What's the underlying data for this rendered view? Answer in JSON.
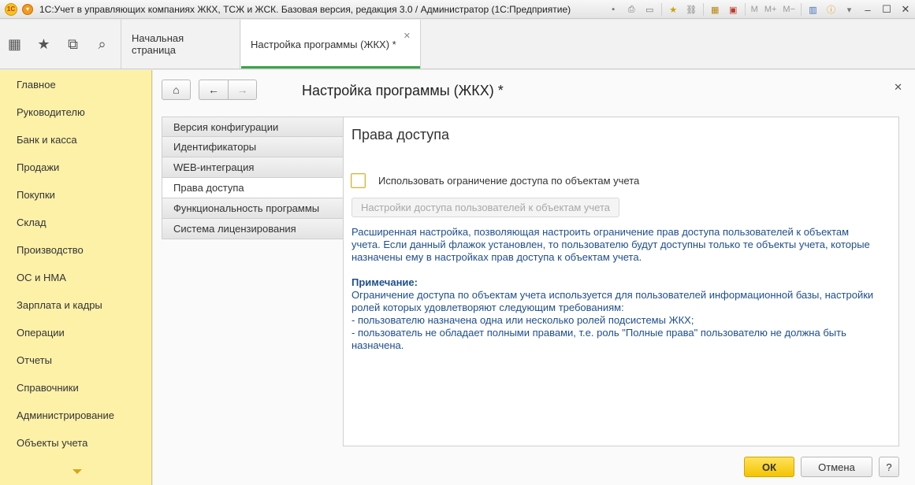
{
  "window": {
    "title": "1С:Учет в управляющих компаниях ЖКХ, ТСЖ и ЖСК. Базовая версия, редакция 3.0 / Администратор  (1С:Предприятие)",
    "logo_text": "1С",
    "toolbar_m": "M",
    "toolbar_m_plus": "M+",
    "toolbar_m_minus": "M−"
  },
  "tabs": {
    "home": "Начальная страница",
    "active": "Настройка программы (ЖКХ) *"
  },
  "sidebar": {
    "items": [
      {
        "label": "Главное"
      },
      {
        "label": "Руководителю"
      },
      {
        "label": "Банк и касса"
      },
      {
        "label": "Продажи"
      },
      {
        "label": "Покупки"
      },
      {
        "label": "Склад"
      },
      {
        "label": "Производство"
      },
      {
        "label": "ОС и НМА"
      },
      {
        "label": "Зарплата и кадры"
      },
      {
        "label": "Операции"
      },
      {
        "label": "Отчеты"
      },
      {
        "label": "Справочники"
      },
      {
        "label": "Администрирование"
      },
      {
        "label": "Объекты учета"
      }
    ]
  },
  "form": {
    "title": "Настройка программы (ЖКХ) *",
    "sections": [
      {
        "label": "Версия конфигурации"
      },
      {
        "label": "Идентификаторы"
      },
      {
        "label": "WEB-интеграция"
      },
      {
        "label": "Права доступа"
      },
      {
        "label": "Функциональность программы"
      },
      {
        "label": "Система лицензирования"
      }
    ],
    "panel": {
      "title": "Права доступа",
      "checkbox_label": "Использовать ограничение доступа по объектам учета",
      "checkbox_checked": false,
      "settings_button": "Настройки доступа пользователей к объектам учета",
      "description": "Расширенная настройка, позволяющая  настроить ограничение прав доступа пользователей к объектам учета. Если данный флажок установлен, то пользователю будут доступны только те объекты учета, которые назначены ему в настройках прав доступа к объектам учета.",
      "note_title": "Примечание:",
      "note_line1": "Ограничение доступа по объектам учета используется для пользователей информационной базы, настройки ролей которых удовлетворяют следующим требованиям:",
      "note_line2": "- пользователю назначена одна или несколько ролей подсистемы ЖКХ;",
      "note_line3": "- пользователь не обладает полными правами, т.е. роль \"Полные права\" пользователю не должна быть назначена."
    },
    "buttons": {
      "ok": "ОК",
      "cancel": "Отмена",
      "help": "?"
    }
  }
}
